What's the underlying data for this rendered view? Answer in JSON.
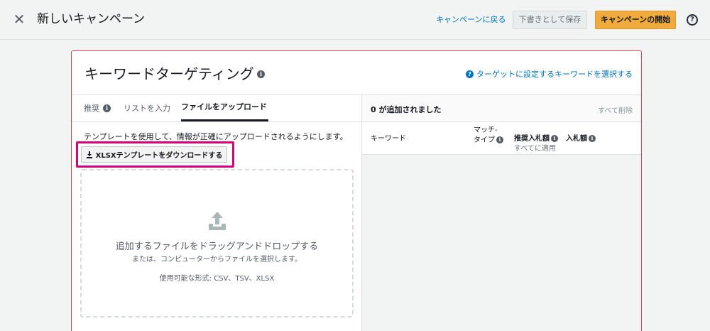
{
  "header": {
    "close_label": "✕",
    "title": "新しいキャンペーン",
    "back_link": "キャンペーンに戻る",
    "draft_button": "下書きとして保存",
    "start_button": "キャンペーンの開始",
    "help_label": "?"
  },
  "card": {
    "title": "キーワードターゲティング",
    "select_link": "ターゲットに設定するキーワードを選択する",
    "tabs": [
      {
        "label": "推奨"
      },
      {
        "label": "リストを入力"
      },
      {
        "label": "ファイルをアップロード"
      }
    ],
    "description": "テンプレートを使用して、情報が正確にアップロードされるようにします。",
    "download_button": "XLSXテンプレートをダウンロードする",
    "dropzone": {
      "main": "追加するファイルをドラッグアンドドロップする",
      "sub": "または、コンピューターからファイルを選択します。",
      "formats": "使用可能な形式: CSV、TSV、XLSX"
    },
    "right": {
      "added": "0 が追加されました",
      "clear_all": "すべて削除",
      "columns": {
        "keyword": "キーワード",
        "match_line1": "マッチ-",
        "match_line2": "タイプ",
        "recommended": "推奨入札額",
        "recommended_sub": "すべてに適用",
        "bid": "入札額"
      }
    }
  },
  "icons": {
    "close": "close-icon",
    "help": "help-icon",
    "info": "info-icon",
    "download": "download-icon",
    "upload": "upload-icon"
  },
  "colors": {
    "accent_link": "#0073bb",
    "primary_button": "#f0ab3c",
    "card_border": "#e0414f",
    "highlight": "#d6007c"
  }
}
